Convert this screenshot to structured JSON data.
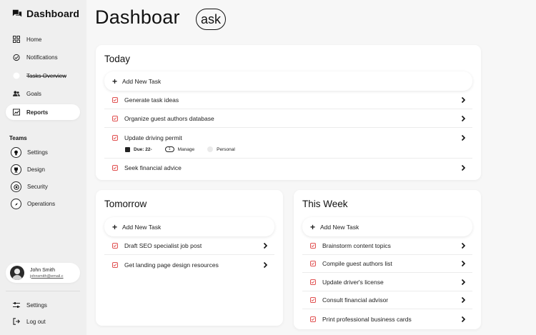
{
  "app": {
    "title": "Dashboard",
    "accent": "#e05050"
  },
  "sidebar": {
    "items": [
      {
        "label": "Home",
        "icon": "grid-icon"
      },
      {
        "label": "Notifications",
        "icon": "check-circle-icon"
      },
      {
        "label": "Tasks Overview",
        "icon": "blank-circle-icon"
      },
      {
        "label": "Goals",
        "icon": "users-icon"
      },
      {
        "label": "Reports",
        "icon": "report-icon"
      }
    ],
    "teams_heading": "Teams",
    "teams": [
      {
        "label": "Settings",
        "icon": "bulb-icon"
      },
      {
        "label": "Design",
        "icon": "trophy-icon"
      },
      {
        "label": "Security",
        "icon": "target-icon"
      },
      {
        "label": "Operations",
        "icon": "compass-icon"
      }
    ],
    "profile": {
      "name": "John Smith",
      "email": "johnsmith@email.c"
    },
    "bottom": [
      {
        "label": "Settings",
        "icon": "sliders-icon"
      },
      {
        "label": "Log out",
        "icon": "logout-icon"
      }
    ]
  },
  "main": {
    "title": "Dashboar",
    "ask_label": "ask"
  },
  "today": {
    "heading": "Today",
    "add_label": "Add New Task",
    "tasks": [
      "Generate task ideas",
      "Organize guest authors database",
      "Update driving permit",
      "Seek financial advice"
    ],
    "meta": {
      "due": "Due: 22-",
      "tag": "Manage",
      "tag_count": "1",
      "category": "Personal"
    }
  },
  "tomorrow": {
    "heading": "Tomorrow",
    "add_label": "Add New Task",
    "tasks": [
      "Draft SEO specialist job post",
      "Get landing page design resources"
    ]
  },
  "this_week": {
    "heading": "This Week",
    "add_label": "Add New Task",
    "tasks": [
      "Brainstorm content topics",
      "Compile guest authors list",
      "Update driver's license",
      "Consult financial advisor",
      "Print professional business cards"
    ]
  }
}
